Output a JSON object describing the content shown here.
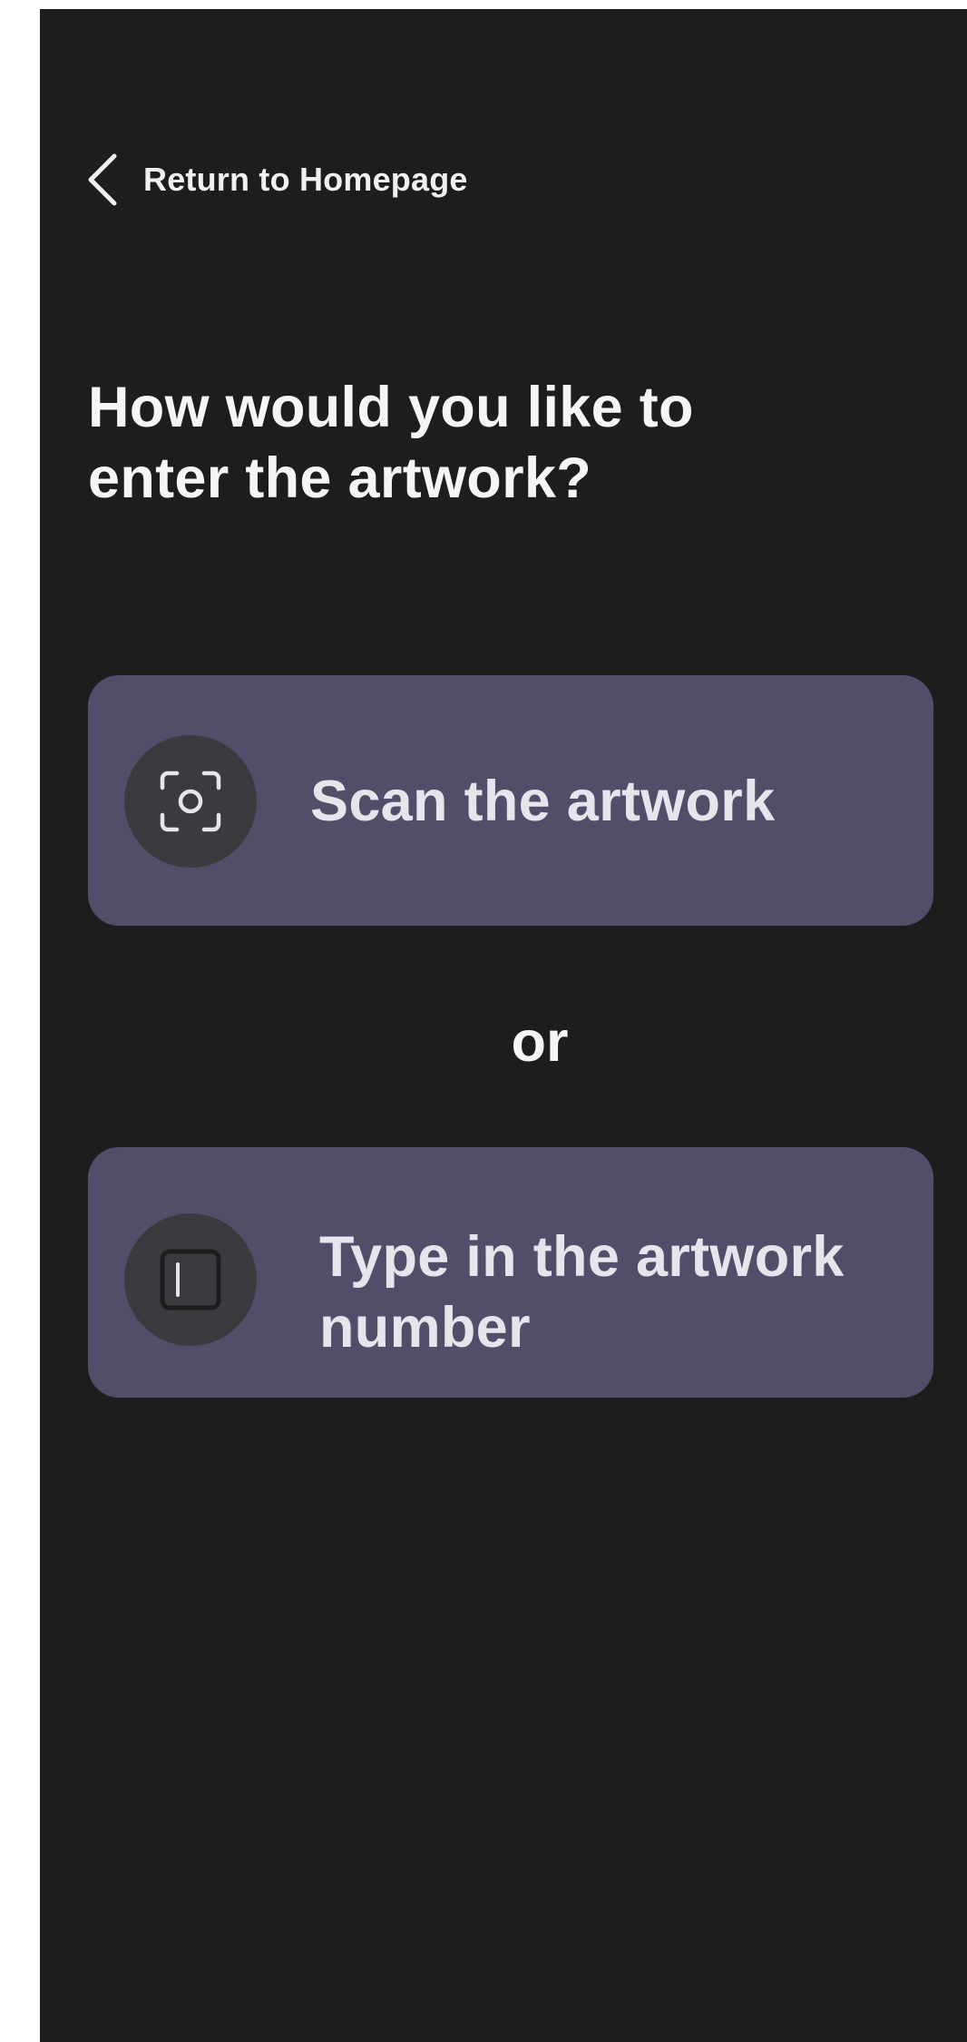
{
  "nav": {
    "back_label": "Return to Homepage",
    "back_icon": "chevron-left-icon"
  },
  "prompt": {
    "title": "How would you like to enter the artwork?"
  },
  "options": {
    "scan": {
      "label": "Scan the artwork",
      "icon": "camera-scan-icon"
    },
    "separator": "or",
    "type": {
      "label": "Type in the artwork number",
      "icon": "text-cursor-icon"
    }
  },
  "colors": {
    "background": "#1c1d1d",
    "option_card": "#514e6a",
    "icon_circle": "#3b3b3f",
    "text_primary": "#f6f4f7",
    "text_option": "#e8e4ec"
  }
}
